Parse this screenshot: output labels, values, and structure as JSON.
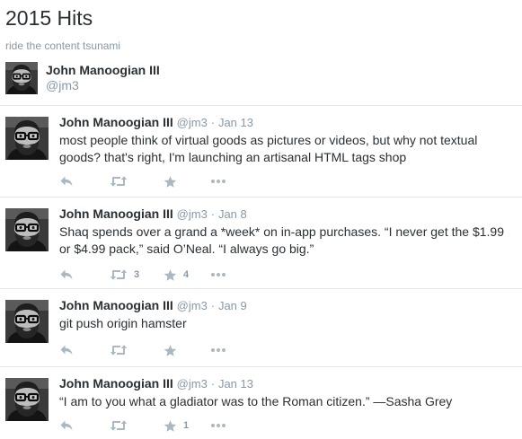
{
  "page": {
    "title": "2015 Hits",
    "subtitle": "ride the content tsunami"
  },
  "curator": {
    "name": "John Manoogian III",
    "handle": "@jm3"
  },
  "tweets": [
    {
      "name": "John Manoogian III",
      "handle": "@jm3",
      "separator": "·",
      "date": "Jan 13",
      "text": "most people think of virtual goods as pictures or videos, but why not textual goods? that's right, I'm launching an artisanal HTML tags shop",
      "retweets": "",
      "favorites": ""
    },
    {
      "name": "John Manoogian III",
      "handle": "@jm3",
      "separator": "·",
      "date": "Jan 8",
      "text": "Shaq spends over a grand a *week* on in-app purchases. “I never get the $1.99 or $4.99 pack,” said O’Neal. “I always go big.”",
      "retweets": "3",
      "favorites": "4"
    },
    {
      "name": "John Manoogian III",
      "handle": "@jm3",
      "separator": "·",
      "date": "Jan 9",
      "text": "git push origin hamster",
      "retweets": "",
      "favorites": ""
    },
    {
      "name": "John Manoogian III",
      "handle": "@jm3",
      "separator": "·",
      "date": "Jan 13",
      "text": "“I am to you what a gladiator was to the Roman citizen.” —Sasha Grey",
      "retweets": "",
      "favorites": "1"
    }
  ],
  "icons": {
    "reply": "reply-icon",
    "retweet": "retweet-icon",
    "favorite": "star-icon",
    "more": "more-dots-icon"
  },
  "colors": {
    "text": "#292f33",
    "muted": "#8899a6",
    "icon": "#aab8c2",
    "divider": "#e1e8ed"
  }
}
